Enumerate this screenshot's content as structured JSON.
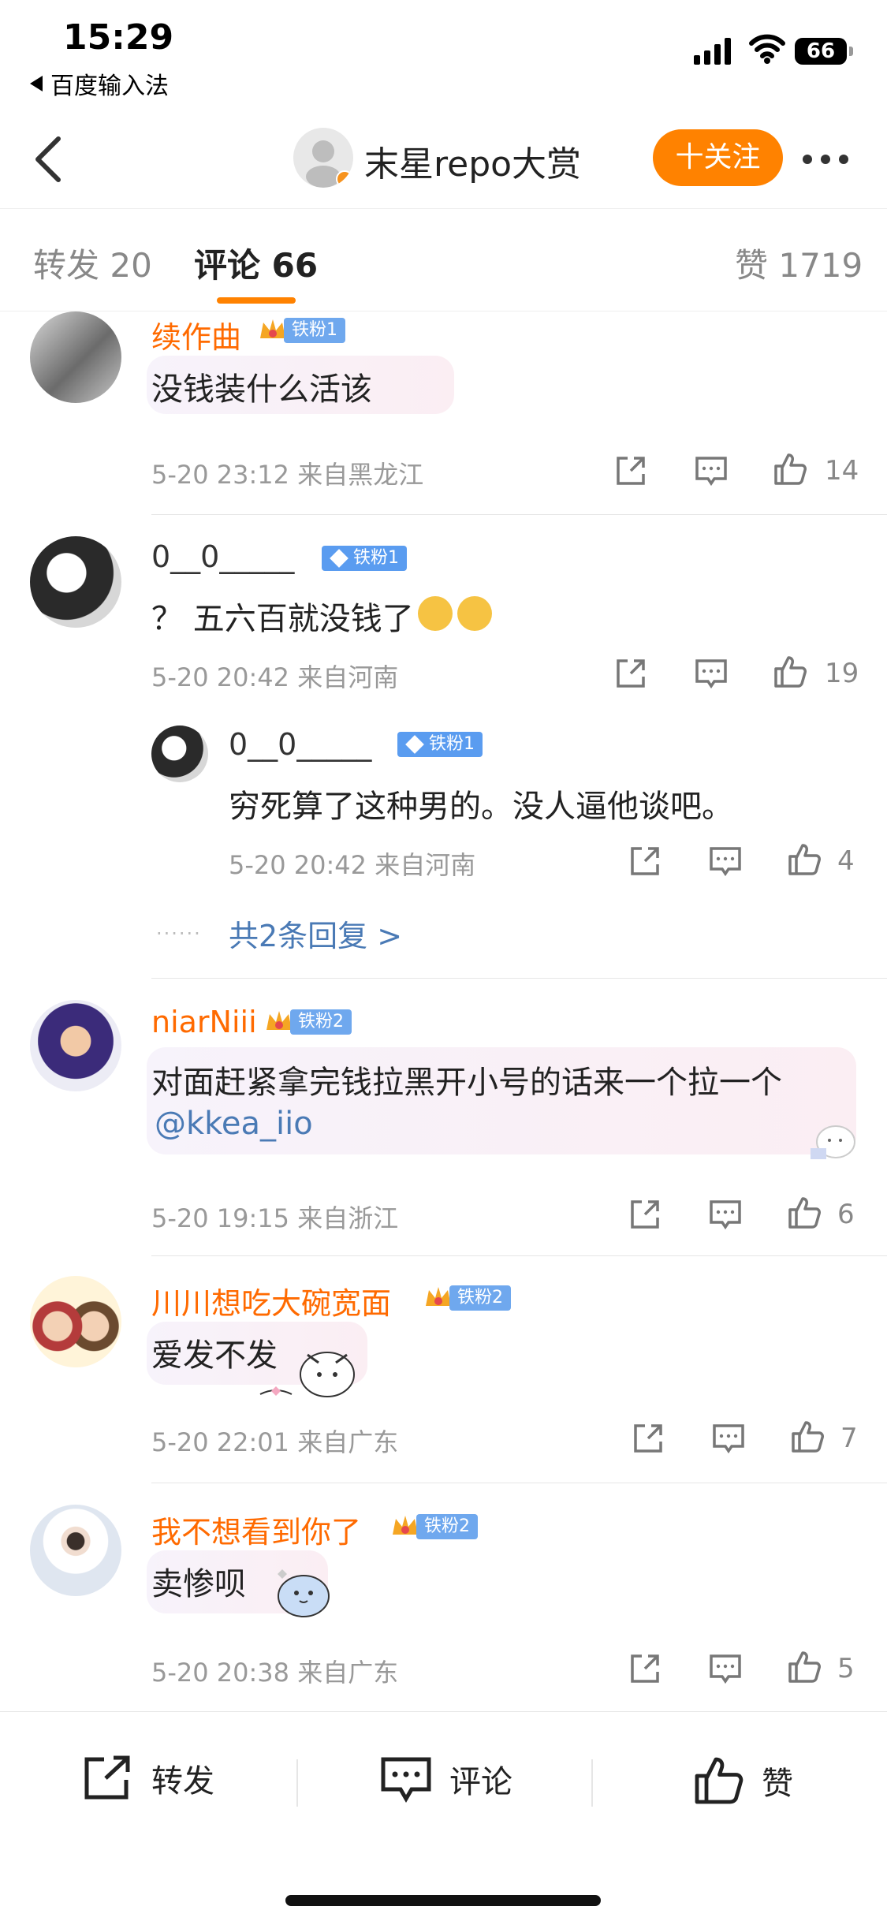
{
  "status_bar": {
    "time": "15:29",
    "back_app": "百度输入法",
    "battery": "66"
  },
  "header": {
    "title": "末星repo大赏",
    "follow_label": "十关注"
  },
  "tabs": [
    {
      "label": "转发 20"
    },
    {
      "label": "评论 66"
    },
    {
      "label": "赞 1719"
    }
  ],
  "comments": [
    {
      "username": "续作曲",
      "badge": "铁粉1",
      "text": "没钱装什么活该",
      "meta": "5-20 23:12 来自黑龙江",
      "likes": "14"
    },
    {
      "username": "0__0_____",
      "badge": "铁粉1",
      "text": "？ 五六百就没钱了",
      "meta": "5-20 20:42 来自河南",
      "likes": "19",
      "reply": {
        "username": "0__0_____",
        "badge": "铁粉1",
        "text": "穷死算了这种男的。没人逼他谈吧。",
        "meta": "5-20 20:42 来自河南",
        "likes": "4"
      },
      "more_replies": "共2条回复 >"
    },
    {
      "username": "niarNiii",
      "badge": "铁粉2",
      "text": "对面赶紧拿完钱拉黑开小号的话来一个拉一个",
      "mention": "@kkea_iio",
      "meta": "5-20 19:15 来自浙江",
      "likes": "6"
    },
    {
      "username": "川川想吃大碗宽面",
      "badge": "铁粉2",
      "text": "爱发不发",
      "meta": "5-20 22:01 来自广东",
      "likes": "7"
    },
    {
      "username": "我不想看到你了",
      "badge": "铁粉2",
      "text": "卖惨呗",
      "meta": "5-20 20:38 来自广东",
      "likes": "5"
    }
  ],
  "bottom_bar": {
    "repost": "转发",
    "comment": "评论",
    "like": "赞"
  },
  "colors": {
    "accent": "#ff8200",
    "username": "#ff6a00",
    "link": "#4a7ab5",
    "badge": "#6fa8ee"
  }
}
